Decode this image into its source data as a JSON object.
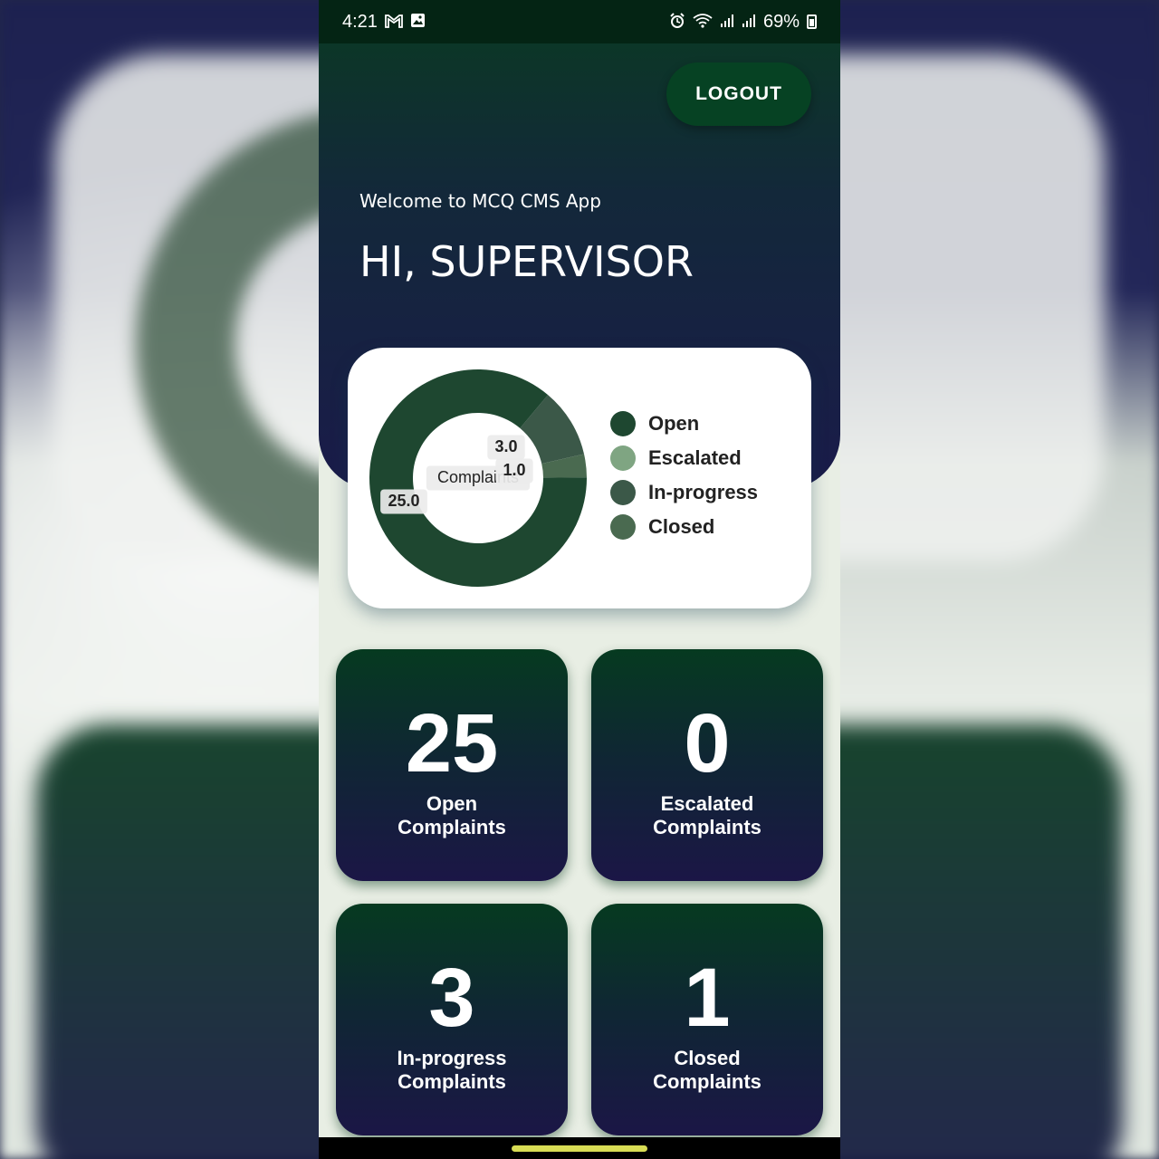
{
  "statusbar": {
    "time": "4:21",
    "battery": "69%",
    "left_icons": [
      "gmail-icon",
      "image-icon"
    ],
    "right_icons": [
      "alarm-icon",
      "wifi-icon",
      "signal-icon",
      "signal-icon",
      "battery-icon"
    ]
  },
  "header": {
    "logout_label": "LOGOUT",
    "welcome": "Welcome to MCQ CMS App",
    "greeting": "HI, SUPERVISOR"
  },
  "chart_data": {
    "type": "pie",
    "center_label": "Complaints",
    "categories": [
      "Open",
      "Escalated",
      "In-progress",
      "Closed"
    ],
    "values": [
      25.0,
      0.0,
      3.0,
      1.0
    ],
    "data_labels": [
      "25.0",
      "3.0",
      "1.0"
    ],
    "colors": [
      "#1e4730",
      "#7fa582",
      "#3b5848",
      "#4a6a50"
    ],
    "legend_position": "right"
  },
  "tiles": [
    {
      "count": "25",
      "line1": "Open",
      "line2": "Complaints"
    },
    {
      "count": "0",
      "line1": "Escalated",
      "line2": "Complaints"
    },
    {
      "count": "3",
      "line1": "In-progress",
      "line2": "Complaints"
    },
    {
      "count": "1",
      "line1": "Closed",
      "line2": "Complaints"
    }
  ]
}
